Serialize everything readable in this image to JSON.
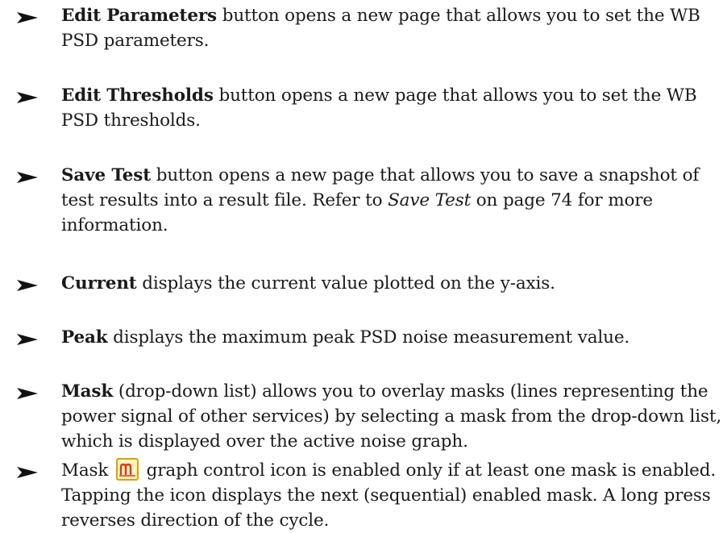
{
  "items": [
    {
      "lead": "Edit Parameters",
      "text": " button opens a new page that allows you to set the WB PSD parameters."
    },
    {
      "lead": "Edit Thresholds",
      "text": " button opens a new page that allows you to set the WB PSD thresholds."
    },
    {
      "lead": "Save Test",
      "text_before": " button opens a new page that allows you to save a snapshot of test results into a result file. Refer to ",
      "ref": "Save Test",
      "text_after": " on page 74 for more information."
    },
    {
      "lead": "Current",
      "text": " displays the current value plotted on the y-axis."
    },
    {
      "lead": "Peak",
      "text": " displays the maximum peak PSD noise measurement value."
    },
    {
      "lead": "Mask",
      "text": " (drop-down list) allows you to overlay masks (lines representing the power signal of other services) by selecting a mask from the drop-down list, which is displayed over the active noise graph."
    },
    {
      "text_before": "Mask",
      "icon": "mask-graph-control-icon",
      "text_after": "graph control icon is enabled only if at least one mask is enabled. Tapping the icon displays the next (sequential) enabled mask. A long press reverses direction of the cycle."
    }
  ],
  "colors": {
    "text": "#1a1a1a",
    "icon_border": "#e0a000",
    "icon_fill": "#fff3c4",
    "icon_glyph": "#d83a1a"
  }
}
